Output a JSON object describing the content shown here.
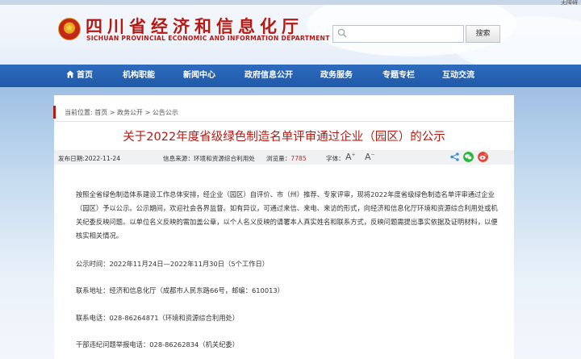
{
  "header": {
    "top_link": "无障碍",
    "site_title": "四川省经济和信息化厅",
    "site_subtitle": "SICHUAN PROVINCIAL ECONOMIC AND INFORMATION DEPARTMENT",
    "search_placeholder": "",
    "search_button": "搜索"
  },
  "nav": {
    "items": [
      "首页",
      "机构职能",
      "新闻中心",
      "政府信息公开",
      "政务服务",
      "专题专栏",
      "互动交流"
    ]
  },
  "breadcrumb": "当前位置: 首页 > 政务公开 > 公告公示",
  "article": {
    "title": "关于2022年度省级绿色制造名单评审通过企业（园区）的公示",
    "publish_label": "发布日期:2022-11-24",
    "source_label": "信息来源：环境和资源综合利用处",
    "views_label": "浏览量：",
    "views_count": "7785",
    "font_label": "字体：",
    "font_larger": "A",
    "font_smaller": "A",
    "paragraph": "按照全省绿色制造体系建设工作总体安排，经企业（园区）自评价、市（州）推荐、专家评审，现将2022年度省级绿色制造名单评审通过企业（园区）予以公示。公示期间，欢迎社会各界监督。如有异议，可通过来信、来电、来访的形式，向经济和信息化厅环境和资源综合利用处或机关纪委反映问题。以单位名义反映的需加盖公章，以个人名义反映的请署本人真实姓名和联系方式，反映问题需提出事实依据及证明材料，以便核实相关情况。",
    "lines": [
      "公示时间：2022年11月24日—2022年11月30日（5个工作日）",
      "联系地址：经济和信息化厅（成都市人民东路66号，邮编：610013）",
      "联系电话：028-86264871（环境和资源综合利用处）",
      "干部违纪问题举报电话：028-86262834（机关纪委）"
    ]
  },
  "colors": {
    "brand_red": "#b51a12",
    "nav_blue": "#1f5aa8"
  }
}
